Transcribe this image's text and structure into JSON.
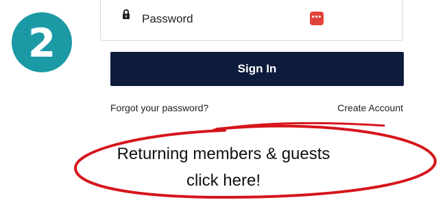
{
  "step": {
    "number": "2",
    "color": "#1b9aa6"
  },
  "password_field": {
    "label": "Password",
    "lock_icon": "lock-icon",
    "manager_icon": "password-manager-icon",
    "manager_icon_color": "#e0413a",
    "manager_icon_glyph": "•••"
  },
  "signin": {
    "label": "Sign In",
    "color": "#0d1b3d"
  },
  "links": {
    "forgot": "Forgot your password?",
    "create": "Create Account"
  },
  "annotation": {
    "line1": "Returning members & guests",
    "line2": "click here!",
    "ellipse_color": "#d6151b"
  }
}
